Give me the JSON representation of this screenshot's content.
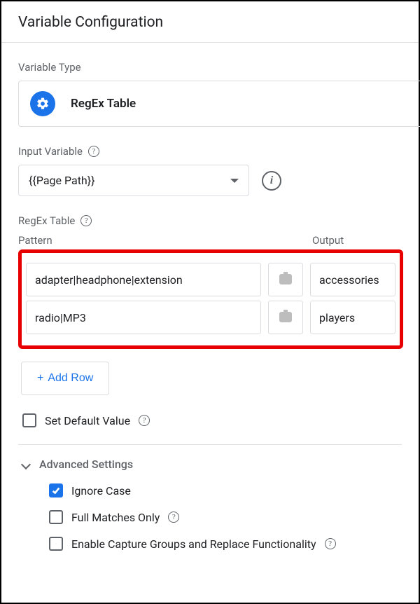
{
  "title": "Variable Configuration",
  "variableType": {
    "label": "Variable Type",
    "name": "RegEx Table"
  },
  "inputVariable": {
    "label": "Input Variable",
    "value": "{{Page Path}}"
  },
  "regexTable": {
    "label": "RegEx Table",
    "patternHeader": "Pattern",
    "outputHeader": "Output",
    "rows": [
      {
        "pattern": "adapter|headphone|extension",
        "output": "accessories"
      },
      {
        "pattern": "radio|MP3",
        "output": "players"
      }
    ],
    "addRowLabel": "Add Row"
  },
  "setDefault": {
    "label": "Set Default Value",
    "checked": false
  },
  "advanced": {
    "title": "Advanced Settings",
    "ignoreCase": {
      "label": "Ignore Case",
      "checked": true
    },
    "fullMatches": {
      "label": "Full Matches Only",
      "checked": false
    },
    "captureGroups": {
      "label": "Enable Capture Groups and Replace Functionality",
      "checked": false
    }
  }
}
